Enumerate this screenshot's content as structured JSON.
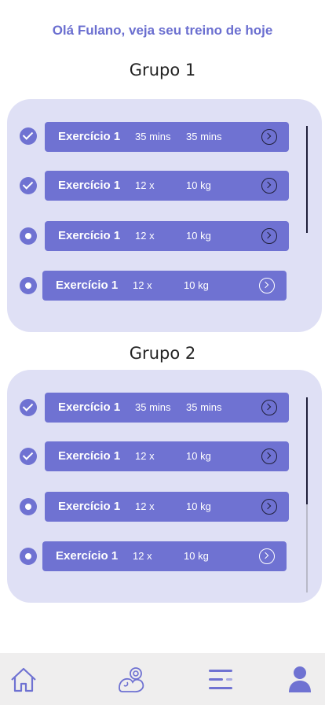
{
  "header": {
    "greeting": "Olá Fulano, veja seu treino de hoje"
  },
  "groups": [
    {
      "title": "Grupo 1",
      "rows": [
        {
          "status": "done",
          "name": "Exercício 1",
          "a": "35 mins",
          "b": "35 mins"
        },
        {
          "status": "done",
          "name": "Exercício 1",
          "a": "12 x",
          "b": "10 kg"
        },
        {
          "status": "pending",
          "name": "Exercício 1",
          "a": "12 x",
          "b": "10 kg"
        },
        {
          "status": "pending",
          "name": "Exercício 1",
          "a": "12 x",
          "b": "10 kg"
        }
      ]
    },
    {
      "title": "Grupo 2",
      "rows": [
        {
          "status": "done",
          "name": "Exercício 1",
          "a": "35 mins",
          "b": "35 mins"
        },
        {
          "status": "done",
          "name": "Exercício 1",
          "a": "12 x",
          "b": "10 kg"
        },
        {
          "status": "pending",
          "name": "Exercício 1",
          "a": "12 x",
          "b": "10 kg"
        },
        {
          "status": "pending",
          "name": "Exercício 1",
          "a": "12 x",
          "b": "10 kg"
        }
      ]
    }
  ],
  "nav": {
    "items": [
      {
        "icon": "home-icon"
      },
      {
        "icon": "workout-icon"
      },
      {
        "icon": "menu-icon"
      },
      {
        "icon": "profile-icon"
      }
    ],
    "accent": "#6f72d2"
  },
  "colors": {
    "accent": "#6f72d2",
    "card": "#dfe0f5",
    "title": "#6b6fd0"
  }
}
